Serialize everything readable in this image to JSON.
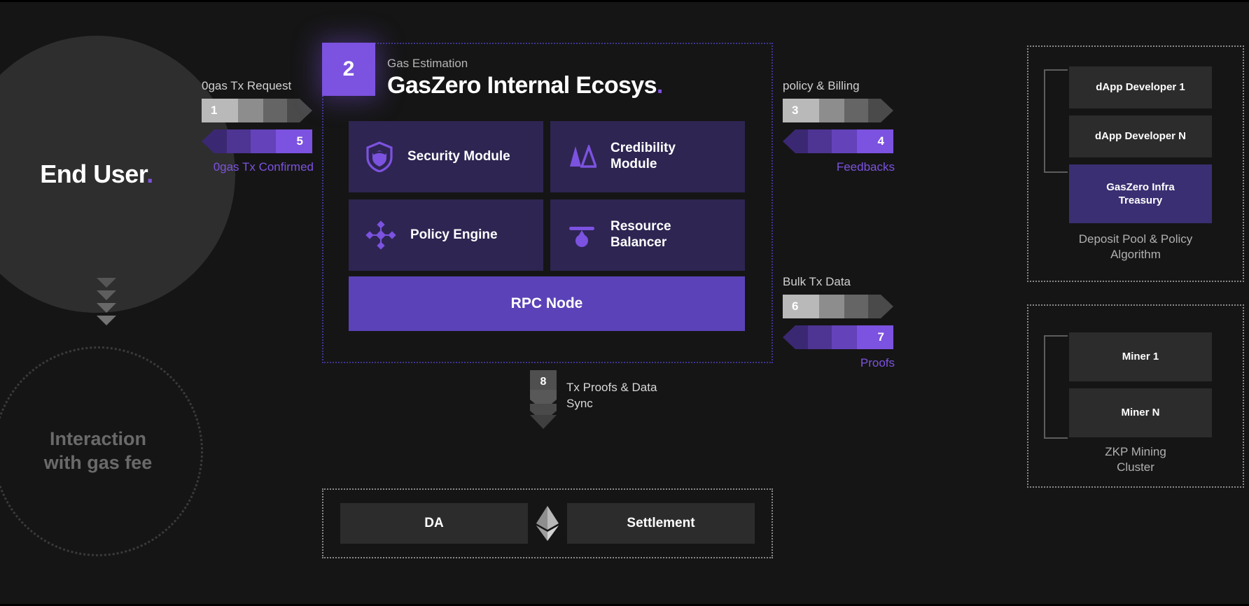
{
  "left": {
    "end_user_label": "End User",
    "end_user_accent": ".",
    "interaction_circle_label": "Interaction\nwith gas fee",
    "interaction_line1": "Interaction",
    "interaction_line2": "with gas fee"
  },
  "flows": {
    "user_request": {
      "top_label": "0gas Tx Request",
      "bottom_label": "0gas Tx Confirmed",
      "forward_num": "1",
      "back_num": "5"
    },
    "policy_billing": {
      "top_label": "policy & Billing",
      "bottom_label": "Feedbacks",
      "forward_num": "3",
      "back_num": "4"
    },
    "bulk_tx": {
      "top_label": "Bulk Tx Data",
      "bottom_label": "Proofs",
      "forward_num": "6",
      "back_num": "7"
    },
    "vertical": {
      "num": "8",
      "label_line1": "Tx Proofs & Data",
      "label_line2": "Sync"
    }
  },
  "ecosystem": {
    "badge_number": "2",
    "subtitle": "Gas Estimation",
    "title": "GasZero Internal Ecosys",
    "title_accent": ".",
    "modules": [
      {
        "name": "Security Module",
        "icon": "shield-icon"
      },
      {
        "name": "Credibility\nModule",
        "icon": "triangles-icon",
        "line1": "Credibility",
        "line2": "Module"
      },
      {
        "name": "Policy Engine",
        "icon": "policy-nodes-icon"
      },
      {
        "name": "Resource\nBalancer",
        "icon": "balancer-icon",
        "line1": "Resource",
        "line2": "Balancer"
      }
    ],
    "rpc_node_label": "RPC Node"
  },
  "bottom": {
    "da_label": "DA",
    "settlement_label": "Settlement",
    "chain_icon": "ethereum-icon"
  },
  "right": {
    "dapp_panel": {
      "items": [
        {
          "label": "dApp Developer 1",
          "highlight": false
        },
        {
          "label": "dApp Developer N",
          "highlight": false
        },
        {
          "label": "GasZero Infra\nTreasury",
          "highlight": true,
          "line1": "GasZero Infra",
          "line2": "Treasury"
        }
      ],
      "caption_line1": "Deposit Pool & Policy",
      "caption_line2": "Algorithm"
    },
    "miner_panel": {
      "items": [
        {
          "label": "Miner 1",
          "highlight": false
        },
        {
          "label": "Miner N",
          "highlight": false
        }
      ],
      "caption_line1": "ZKP Mining",
      "caption_line2": "Cluster"
    }
  },
  "colors": {
    "background": "#151515",
    "accent_purple": "#7c52e0",
    "module_card": "#2e2552",
    "rpc_node": "#5b42b8",
    "treasury": "#3a2f72",
    "node_box": "#2c2c2c",
    "circle_gray": "#2e2e2e"
  }
}
